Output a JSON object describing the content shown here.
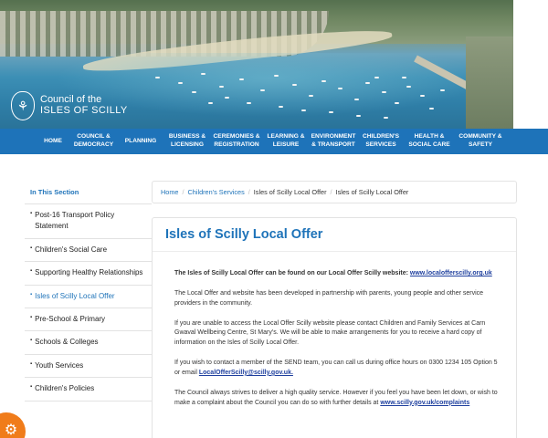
{
  "brand": {
    "line1": "Council of the",
    "line2": "ISLES OF SCILLY",
    "seal_icon": "council-crest-icon"
  },
  "nav": [
    {
      "label": "HOME"
    },
    {
      "label": "COUNCIL &\nDEMOCRACY"
    },
    {
      "label": "PLANNING"
    },
    {
      "label": "BUSINESS &\nLICENSING"
    },
    {
      "label": "CEREMONIES &\nREGISTRATION"
    },
    {
      "label": "LEARNING &\nLEISURE"
    },
    {
      "label": "ENVIRONMENT\n& TRANSPORT"
    },
    {
      "label": "CHILDREN'S\nSERVICES"
    },
    {
      "label": "HEALTH &\nSOCIAL CARE"
    },
    {
      "label": "COMMUNITY &\nSAFETY"
    }
  ],
  "sidebar": {
    "heading": "In This Section",
    "items": [
      {
        "label": "Post-16 Transport Policy Statement",
        "active": false
      },
      {
        "label": "Children's Social Care",
        "active": false
      },
      {
        "label": "Supporting Healthy Relationships",
        "active": false
      },
      {
        "label": "Isles of Scilly Local Offer",
        "active": true
      },
      {
        "label": "Pre-School & Primary",
        "active": false
      },
      {
        "label": "Schools & Colleges",
        "active": false
      },
      {
        "label": "Youth Services",
        "active": false
      },
      {
        "label": "Children's Policies",
        "active": false
      }
    ]
  },
  "breadcrumb": {
    "home": "Home",
    "section": "Children's Services",
    "parent": "Isles of Scilly Local Offer",
    "current": "Isles of Scilly Local Offer",
    "separator": "/"
  },
  "content": {
    "title": "Isles of Scilly Local Offer",
    "intro_bold": "The Isles of Scilly Local Offer can be found on our Local Offer Scilly website:",
    "intro_link": "www.localofferscilly.org.uk",
    "p2": "The Local Offer and website has been developed in partnership with parents, young people and other service providers in the community.",
    "p3": "If you are unable to access the Local Offer Scilly website please contact Children and Family Services at Carn Gwaval Wellbeing Centre, St Mary's. We will be able to make arrangements for you to receive a hard copy of information on the Isles of Scilly Local Offer.",
    "p4_text": "If you wish to contact a member of the SEND team, you can call us during office hours on 0300 1234 105 Option 5 or email",
    "p4_link": "LocalOfferScilly@scilly.gov.uk.",
    "p5_text": "The Council always strives to deliver a high quality service. However if you feel you have been let down, or wish to make a complaint about the Council you can do so with further details at",
    "p5_link": "www.scilly.gov.uk/complaints"
  },
  "colors": {
    "accent": "#1e73b9",
    "accessibility_button": "#f07c1a"
  },
  "accessibility": {
    "icon": "gear-icon"
  }
}
